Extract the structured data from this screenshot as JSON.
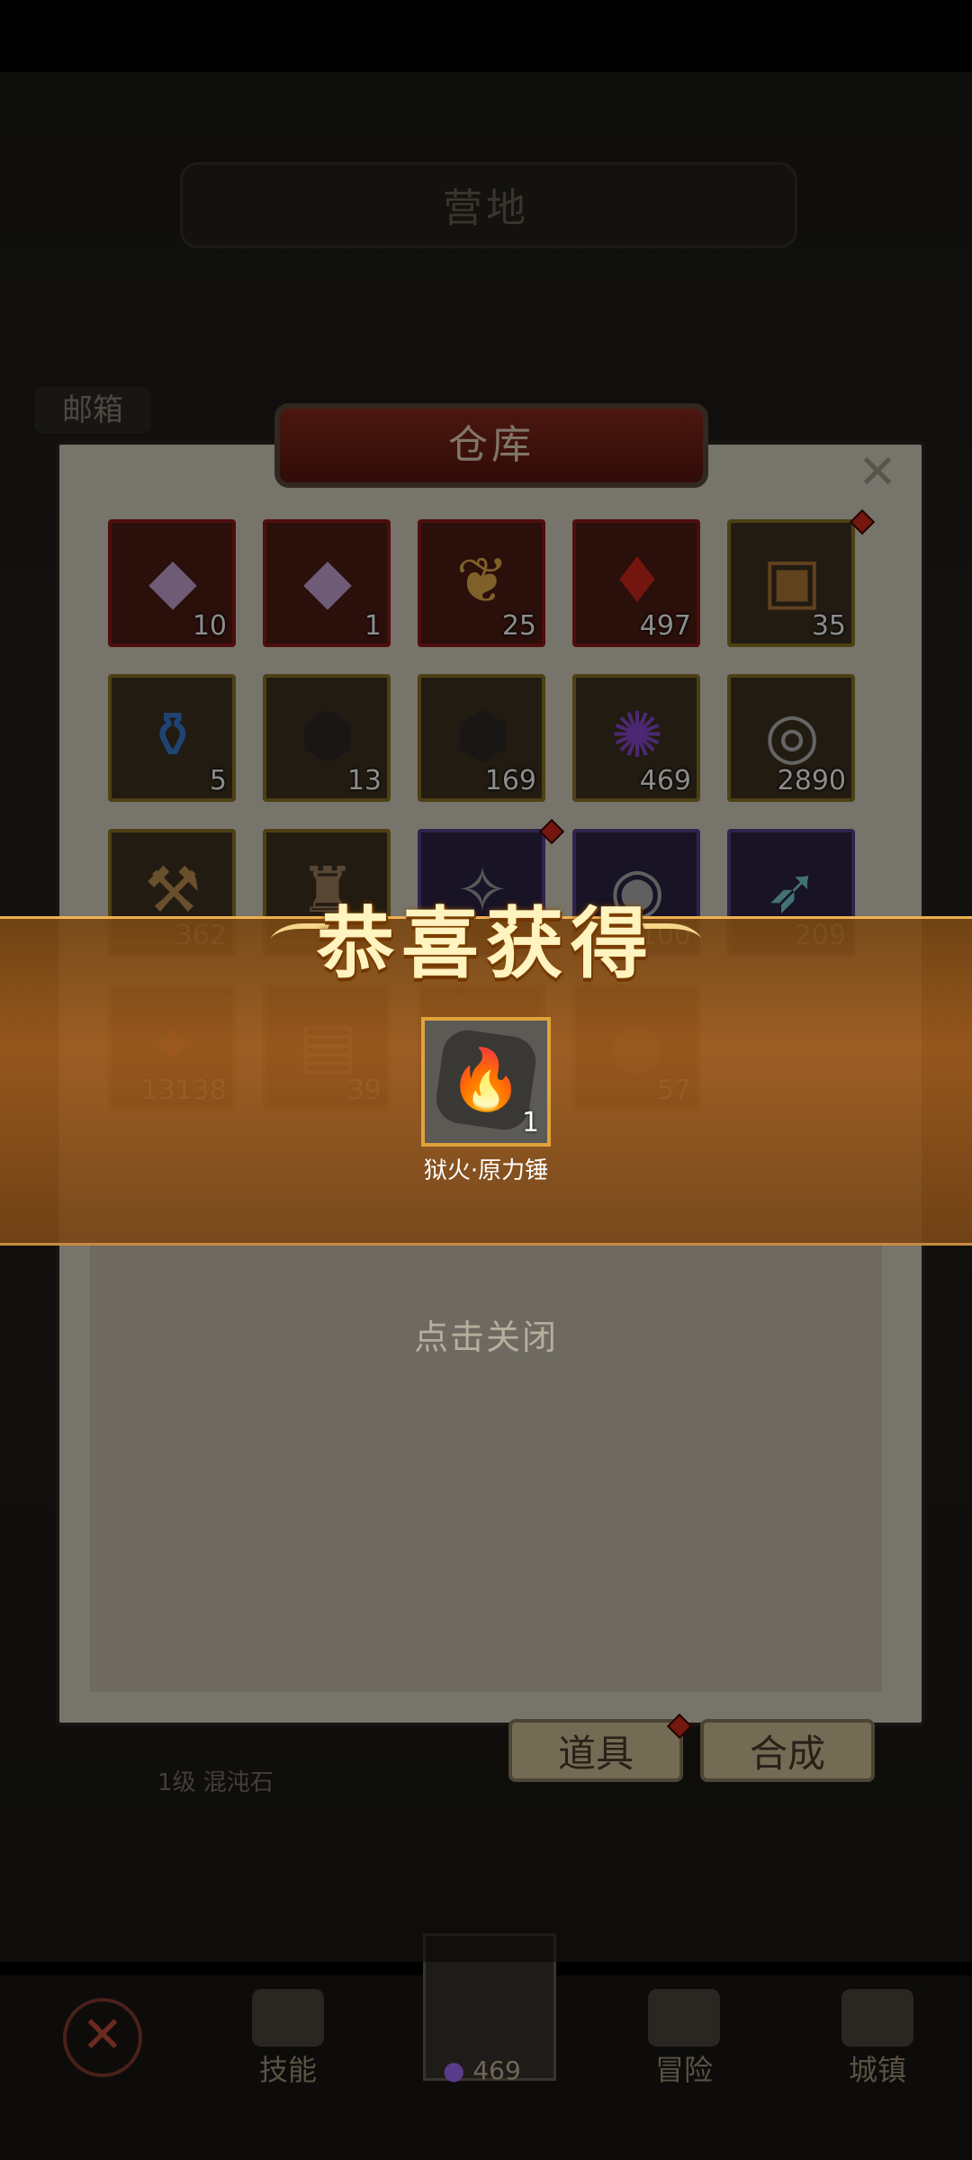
{
  "header": {
    "camp_title": "营地",
    "mailbox": "邮箱"
  },
  "storage": {
    "title": "仓库",
    "close_glyph": "✕",
    "rows": [
      [
        {
          "count": "10",
          "icon": "crystal-shard-icon",
          "frame": "red"
        },
        {
          "count": "1",
          "icon": "crystal-shard-icon",
          "frame": "red"
        },
        {
          "count": "25",
          "icon": "golden-feather-icon",
          "frame": "red"
        },
        {
          "count": "497",
          "icon": "red-gem-icon",
          "frame": "red"
        },
        {
          "count": "35",
          "icon": "treasure-chest-icon",
          "frame": "gold"
        }
      ],
      [
        {
          "count": "5",
          "icon": "potion-flask-icon",
          "frame": "gold"
        },
        {
          "count": "13",
          "icon": "dark-ore-icon",
          "frame": "gold"
        },
        {
          "count": "169",
          "icon": "dark-ore-icon",
          "frame": "gold"
        },
        {
          "count": "469",
          "icon": "purple-flame-icon",
          "frame": "gold"
        },
        {
          "count": "2890",
          "icon": "silver-coin-icon",
          "frame": "gold"
        }
      ],
      [
        {
          "count": "362",
          "icon": "hammer-icon",
          "frame": "gold"
        },
        {
          "count": "",
          "icon": "stone-totem-icon",
          "frame": "gold"
        },
        {
          "count": "",
          "icon": "rune-icon",
          "frame": "purple"
        },
        {
          "count": "100",
          "icon": "stone-disc-icon",
          "frame": "purple"
        },
        {
          "count": "209",
          "icon": "feather-icon",
          "frame": "purple"
        }
      ],
      [
        {
          "count": "13138",
          "icon": "red-crystal-icon",
          "frame": "gold"
        },
        {
          "count": "39",
          "icon": "scroll-icon",
          "frame": "gold"
        },
        {
          "count": "",
          "icon": "empty-icon",
          "frame": "gold"
        },
        {
          "count": "57",
          "icon": "item-icon",
          "frame": "gold"
        }
      ]
    ]
  },
  "reward": {
    "title": "恭喜获得",
    "item_name": "狱火·原力锤",
    "item_count": "1",
    "icon": "fire-stone-icon"
  },
  "tap_close": "点击关闭",
  "tabs": {
    "props": "道具",
    "synthesis": "合成"
  },
  "base_label": "1级 混沌石",
  "bottom_nav": {
    "skills": "技能",
    "gem_count": "469",
    "adventure": "冒险",
    "city": "城镇"
  },
  "colors": {
    "accent_gold": "#e0a23a",
    "reward_band": "#a05c1e",
    "badge_red": "#d42b1a"
  }
}
